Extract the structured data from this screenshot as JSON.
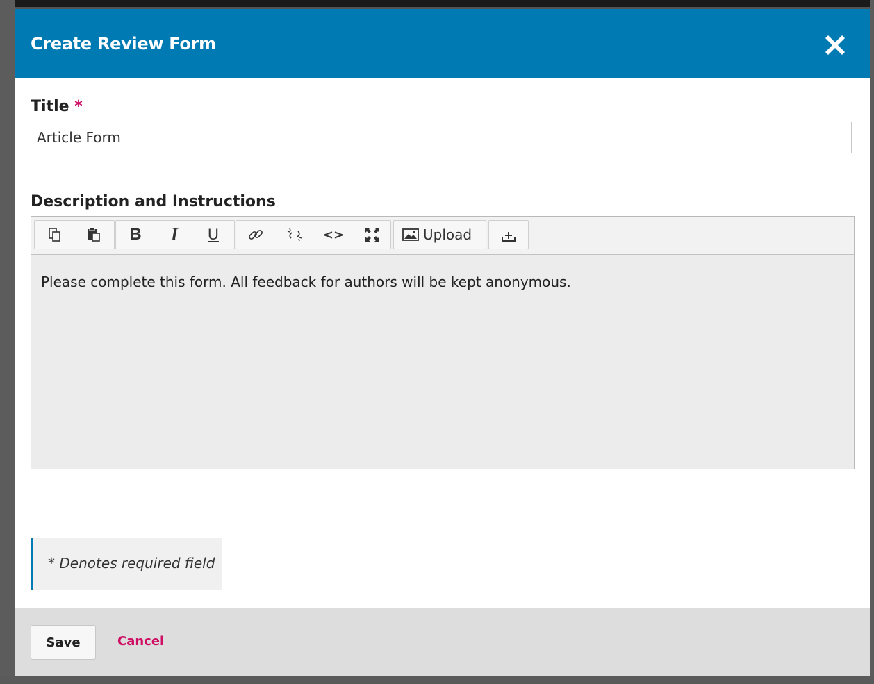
{
  "modal": {
    "title": "Create Review Form",
    "close_icon": "close-icon"
  },
  "form": {
    "title_label": "Title",
    "required_marker": "*",
    "title_value": "Article Form",
    "description_label": "Description and Instructions",
    "description_value": "Please complete this form. All feedback for authors will be kept anonymous."
  },
  "toolbar": {
    "buttons": [
      {
        "name": "copy-icon"
      },
      {
        "name": "paste-icon"
      },
      {
        "name": "bold-icon",
        "label": "B"
      },
      {
        "name": "italic-icon",
        "label": "I"
      },
      {
        "name": "underline-icon",
        "label": "U"
      },
      {
        "name": "link-icon"
      },
      {
        "name": "unlink-icon"
      },
      {
        "name": "code-icon",
        "label": "<>"
      },
      {
        "name": "fullscreen-icon"
      },
      {
        "name": "image-icon"
      },
      {
        "name": "upload-icon"
      }
    ],
    "upload_label": "Upload"
  },
  "notice": {
    "text": "* Denotes required field"
  },
  "footer": {
    "save_label": "Save",
    "cancel_label": "Cancel"
  },
  "colors": {
    "header": "#007ab2",
    "accent": "#cf0f64"
  }
}
